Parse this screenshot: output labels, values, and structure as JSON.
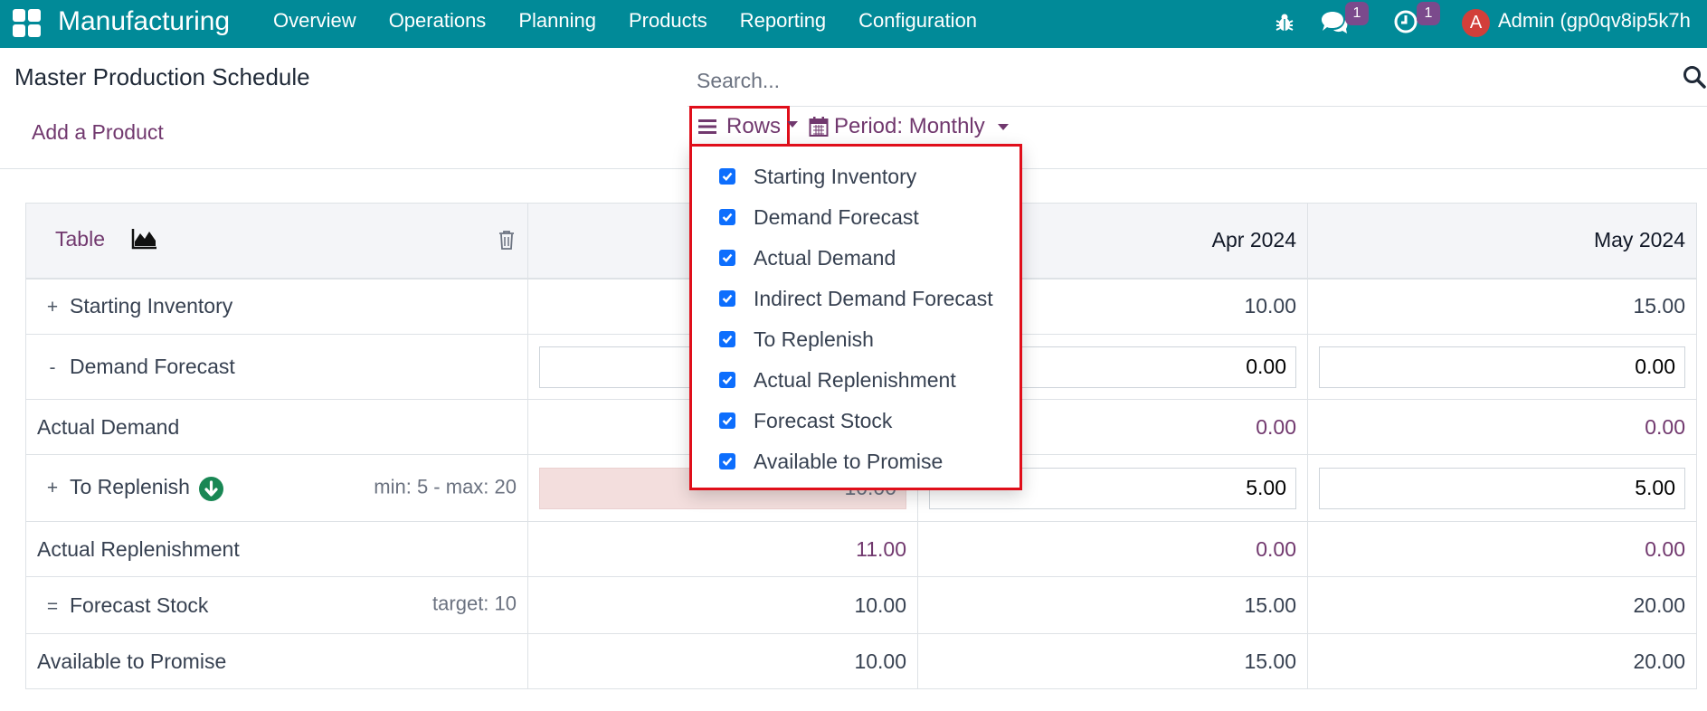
{
  "navbar": {
    "app_name": "Manufacturing",
    "menu": [
      "Overview",
      "Operations",
      "Planning",
      "Products",
      "Reporting",
      "Configuration"
    ],
    "messages_count": "1",
    "activities_count": "1",
    "avatar_letter": "A",
    "user": "Admin (gp0qv8ip5k7h"
  },
  "control_panel": {
    "title": "Master Production Schedule",
    "search_placeholder": "Search...",
    "add_product": "Add a Product",
    "rows_button": "Rows",
    "period_button": "Period: Monthly"
  },
  "table": {
    "view_label": "Table",
    "months": [
      "",
      "Apr 2024",
      "May 2024"
    ],
    "rows": {
      "starting_inventory": {
        "sign": "+",
        "label": "Starting Inventory",
        "values": [
          "",
          "10.00",
          "15.00"
        ]
      },
      "demand_forecast": {
        "sign": "-",
        "label": "Demand Forecast",
        "values": [
          "",
          "0.00",
          "0.00"
        ]
      },
      "actual_demand": {
        "label": "Actual Demand",
        "values": [
          "",
          "0.00",
          "0.00"
        ]
      },
      "to_replenish": {
        "sign": "+",
        "label": "To Replenish",
        "extra": "min: 5 - max: 20",
        "values": [
          "10.00",
          "5.00",
          "5.00"
        ]
      },
      "actual_replenishment": {
        "label": "Actual Replenishment",
        "values": [
          "11.00",
          "0.00",
          "0.00"
        ]
      },
      "forecast_stock": {
        "sign": "=",
        "label": "Forecast Stock",
        "extra": "target: 10",
        "values": [
          "10.00",
          "15.00",
          "20.00"
        ]
      },
      "available_to_promise": {
        "label": "Available to Promise",
        "values": [
          "10.00",
          "15.00",
          "20.00"
        ]
      }
    }
  },
  "rows_dropdown": {
    "items": [
      {
        "label": "Starting Inventory",
        "checked": true
      },
      {
        "label": "Demand Forecast",
        "checked": true
      },
      {
        "label": "Actual Demand",
        "checked": true
      },
      {
        "label": "Indirect Demand Forecast",
        "checked": true
      },
      {
        "label": "To Replenish",
        "checked": true
      },
      {
        "label": "Actual Replenishment",
        "checked": true
      },
      {
        "label": "Forecast Stock",
        "checked": true
      },
      {
        "label": "Available to Promise",
        "checked": true
      }
    ]
  },
  "colors": {
    "navbar": "#018a98",
    "accent": "#71386e",
    "highlight_border": "#e00e1a",
    "checkbox": "#0d6efd",
    "replenish_icon": "#198754",
    "danger_fill": "#f3dedd"
  },
  "icons": [
    "apps-grid-icon",
    "bug-icon",
    "chat-icon",
    "clock-icon",
    "search-icon",
    "bars-icon",
    "calendar-icon",
    "area-chart-icon",
    "trash-icon",
    "arrow-down-circle-icon",
    "check-icon"
  ]
}
